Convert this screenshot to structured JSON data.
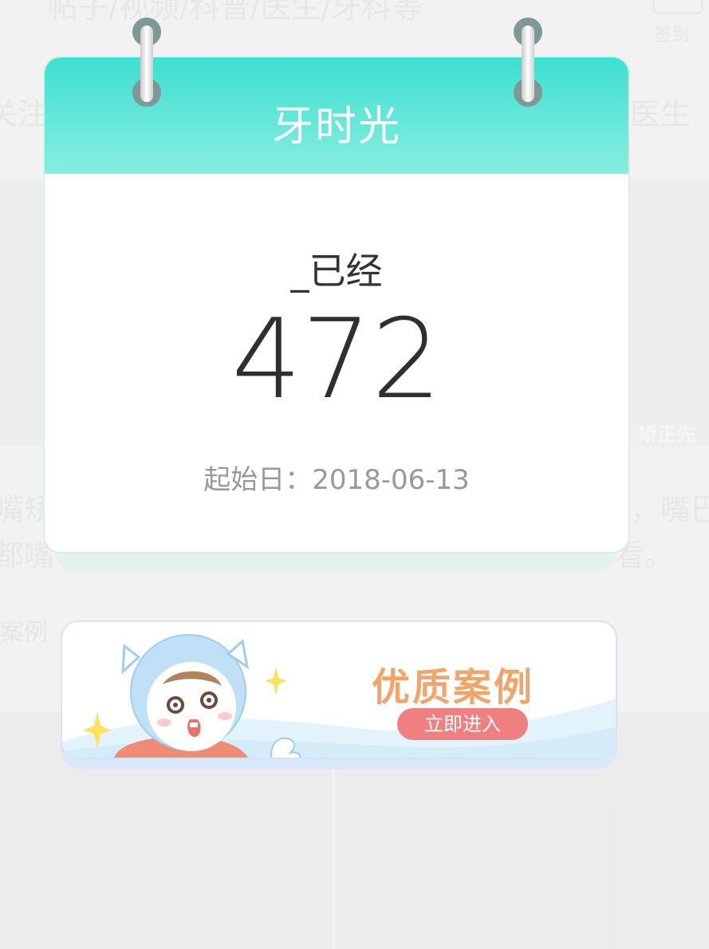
{
  "background": {
    "top_text": "帖子/视频/科普/医生/牙科等",
    "checkin_label": "签到",
    "follow_tab": "关注",
    "doctor_tab": "医生",
    "side_tag": "矫正先",
    "post_line1_left": "嘴矫",
    "post_line1_right": "，嘴巴",
    "post_line2_left": "都嘴",
    "post_line2_right": "看。",
    "case_label": "案例"
  },
  "calendar": {
    "title": "牙时光",
    "label": "_已经",
    "days": "472",
    "start_date": "起始日：2018-06-13"
  },
  "banner": {
    "title": "优质案例",
    "button": "立即进入"
  },
  "colors": {
    "header_top": "#3edfd1",
    "header_bottom": "#86eedf",
    "banner_title": "#f2a56a",
    "banner_button": "#f08080"
  }
}
